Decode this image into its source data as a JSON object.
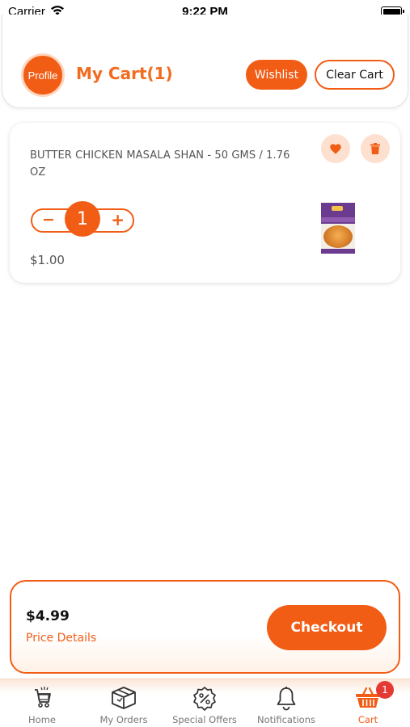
{
  "status_bar": {
    "carrier": "Carrier",
    "time": "9:22 PM"
  },
  "header": {
    "profile_label": "Profile",
    "title": "My Cart(1)",
    "wishlist_label": "Wishlist",
    "clear_cart_label": "Clear Cart"
  },
  "cart_items": [
    {
      "name": "BUTTER CHICKEN MASALA SHAN - 50 GMS / 1.76 OZ",
      "quantity": "1",
      "minus_label": "−",
      "plus_label": "+",
      "price": "$1.00",
      "image_icon": "product-image"
    }
  ],
  "checkout": {
    "total": "$4.99",
    "price_details_label": "Price Details",
    "checkout_label": "Checkout"
  },
  "tab_bar": {
    "tabs": [
      {
        "label": "Home",
        "icon": "shopping-cart-icon",
        "active": false
      },
      {
        "label": "My Orders",
        "icon": "package-icon",
        "active": false
      },
      {
        "label": "Special Offers",
        "icon": "discount-badge-icon",
        "active": false
      },
      {
        "label": "Notifications",
        "icon": "bell-icon",
        "active": false
      },
      {
        "label": "Cart",
        "icon": "basket-icon",
        "active": true
      }
    ],
    "cart_badge": "1"
  },
  "colors": {
    "accent": "#f25d16",
    "accent_light": "#fde0cf",
    "badge": "#e53935"
  }
}
